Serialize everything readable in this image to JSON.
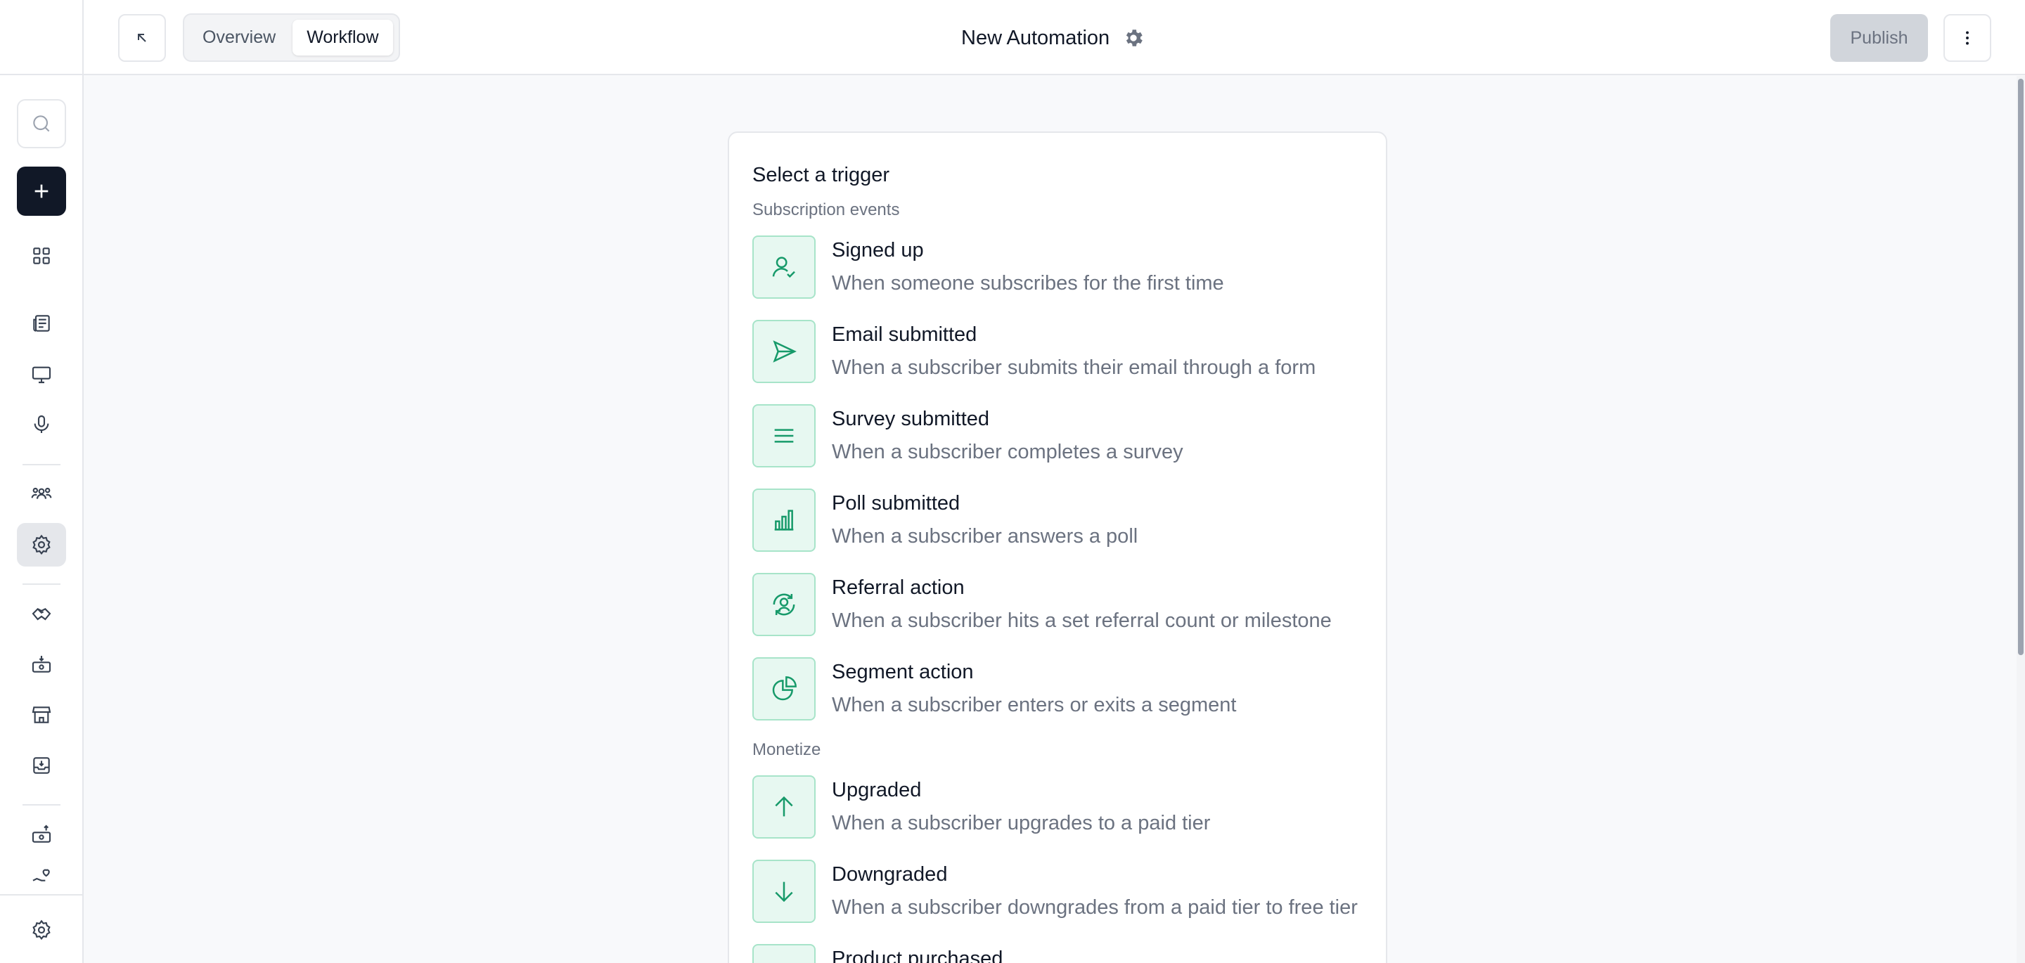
{
  "header": {
    "tabs": [
      {
        "label": "Overview",
        "active": false
      },
      {
        "label": "Workflow",
        "active": true
      }
    ],
    "title": "New Automation",
    "publish_label": "Publish"
  },
  "card": {
    "title": "Select a trigger",
    "sections": [
      {
        "label": "Subscription events",
        "items": [
          {
            "name": "Signed up",
            "description": "When someone subscribes for the first time",
            "icon": "user-check-icon"
          },
          {
            "name": "Email submitted",
            "description": "When a subscriber submits their email through a form",
            "icon": "send-icon"
          },
          {
            "name": "Survey submitted",
            "description": "When a subscriber completes a survey",
            "icon": "lines-icon"
          },
          {
            "name": "Poll submitted",
            "description": "When a subscriber answers a poll",
            "icon": "bar-chart-icon"
          },
          {
            "name": "Referral action",
            "description": "When a subscriber hits a set referral count or milestone",
            "icon": "user-refresh-icon"
          },
          {
            "name": "Segment action",
            "description": "When a subscriber enters or exits a segment",
            "icon": "pie-chart-icon"
          }
        ]
      },
      {
        "label": "Monetize",
        "items": [
          {
            "name": "Upgraded",
            "description": "When a subscriber upgrades to a paid tier",
            "icon": "arrow-up-icon"
          },
          {
            "name": "Downgraded",
            "description": "When a subscriber downgrades from a paid tier to free tier",
            "icon": "arrow-down-icon"
          },
          {
            "name": "Product purchased",
            "description": "",
            "icon": "cart-icon"
          }
        ]
      }
    ]
  },
  "colors": {
    "accent_green": "#179a6a",
    "icon_bg": "#e7f8f1",
    "publish_disabled_bg": "#d1d5db",
    "primary_dark": "#111827"
  }
}
